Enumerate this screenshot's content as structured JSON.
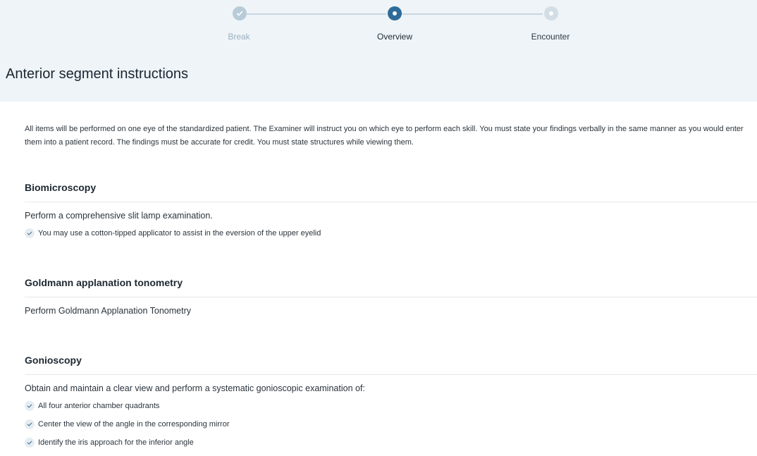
{
  "stepper": {
    "steps": [
      {
        "label": "Break",
        "state": "done"
      },
      {
        "label": "Overview",
        "state": "active"
      },
      {
        "label": "Encounter",
        "state": "pending"
      }
    ]
  },
  "page": {
    "title": "Anterior segment instructions",
    "intro": "All items will be performed on one eye of the standardized patient. The Examiner will instruct you on which eye to perform each skill. You must state your findings verbally in the same manner as you would enter them into a patient record. The findings must be accurate for credit. You must state structures while viewing them."
  },
  "sections": [
    {
      "title": "Biomicroscopy",
      "description": "Perform a comprehensive slit lamp examination.",
      "items": [
        "You may use a cotton-tipped applicator to assist in the eversion of the upper eyelid"
      ]
    },
    {
      "title": "Goldmann applanation tonometry",
      "description": "Perform Goldmann Applanation Tonometry",
      "items": []
    },
    {
      "title": "Gonioscopy",
      "description": "Obtain and maintain a clear view and perform a systematic gonioscopic examination of:",
      "items": [
        "All four anterior chamber quadrants",
        "Center the view of the angle in the corresponding mirror",
        "Identify the iris approach for the inferior angle"
      ]
    }
  ],
  "colors": {
    "header_bg": "#eef4f8",
    "accent": "#2e6b99",
    "step_done": "#b8cbd8",
    "step_pending": "#d2dde5"
  },
  "icons": {
    "step_done": "check-icon",
    "step_active": "dot-icon",
    "step_pending": "dot-icon",
    "list_item": "check-circle-icon"
  }
}
